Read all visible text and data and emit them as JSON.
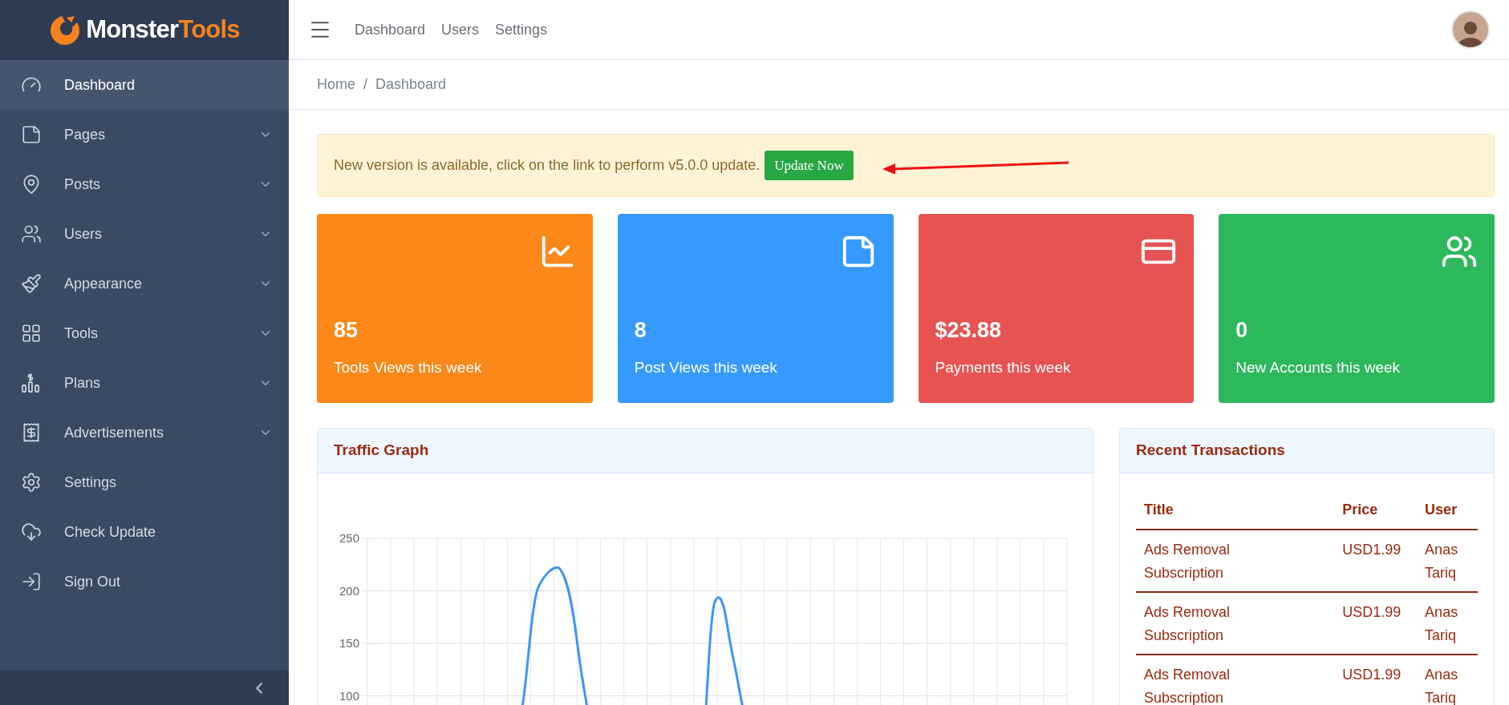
{
  "logo": {
    "first": "Monster",
    "second": "Tools"
  },
  "sidebar": {
    "items": [
      {
        "label": "Dashboard",
        "kind": "gauge",
        "selected": true,
        "expandable": false
      },
      {
        "label": "Pages",
        "kind": "note",
        "selected": false,
        "expandable": true
      },
      {
        "label": "Posts",
        "kind": "pin",
        "selected": false,
        "expandable": true
      },
      {
        "label": "Users",
        "kind": "users",
        "selected": false,
        "expandable": true
      },
      {
        "label": "Appearance",
        "kind": "brush",
        "selected": false,
        "expandable": true
      },
      {
        "label": "Tools",
        "kind": "grid",
        "selected": false,
        "expandable": true
      },
      {
        "label": "Plans",
        "kind": "plans",
        "selected": false,
        "expandable": true
      },
      {
        "label": "Advertisements",
        "kind": "receipt",
        "selected": false,
        "expandable": true
      },
      {
        "label": "Settings",
        "kind": "gear",
        "selected": false,
        "expandable": false
      },
      {
        "label": "Check Update",
        "kind": "cloud",
        "selected": false,
        "expandable": false
      },
      {
        "label": "Sign Out",
        "kind": "signout",
        "selected": false,
        "expandable": false
      }
    ]
  },
  "topbar": {
    "links": [
      "Dashboard",
      "Users",
      "Settings"
    ]
  },
  "breadcrumb": {
    "items": [
      "Home",
      "Dashboard"
    ],
    "separator": "/"
  },
  "alert": {
    "text": "New version is available, click on the link to perform v5.0.0 update.",
    "button": "Update Now"
  },
  "stats": [
    {
      "value": "85",
      "label": "Tools Views this week",
      "color": "#fb8818",
      "kind": "chart"
    },
    {
      "value": "8",
      "label": "Post Views this week",
      "color": "#3699fe",
      "kind": "note"
    },
    {
      "value": "$23.88",
      "label": "Payments this week",
      "color": "#e55353",
      "kind": "card"
    },
    {
      "value": "0",
      "label": "New Accounts this week",
      "color": "#2eb85c",
      "kind": "users"
    }
  ],
  "traffic": {
    "title": "Traffic Graph",
    "y_axis_labels": [
      "250",
      "200",
      "150",
      "100"
    ]
  },
  "transactions": {
    "title": "Recent Transactions",
    "columns": [
      "Title",
      "Price",
      "User"
    ],
    "rows": [
      [
        "Ads Removal Subscription",
        "USD1.99",
        "Anas Tariq"
      ],
      [
        "Ads Removal Subscription",
        "USD1.99",
        "Anas Tariq"
      ],
      [
        "Ads Removal Subscription",
        "USD1.99",
        "Anas Tariq"
      ]
    ]
  }
}
